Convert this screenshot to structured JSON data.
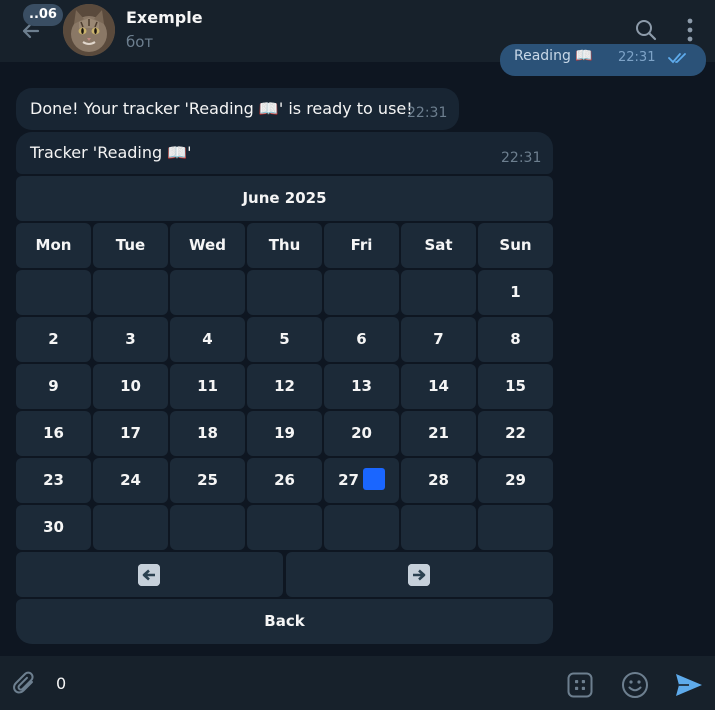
{
  "header": {
    "unread_count": "..06",
    "title": "Exemple",
    "subtitle": "бот",
    "icons": [
      "back-arrow-icon",
      "search-icon",
      "more-vertical-icon"
    ]
  },
  "previous_message": {
    "text": "Reading 📖",
    "time": "22:31",
    "status": "read"
  },
  "messages": [
    {
      "text": "Done! Your tracker 'Reading 📖' is ready to use!",
      "time": "22:31"
    },
    {
      "text": "Tracker 'Reading 📖'",
      "time": "22:31"
    }
  ],
  "calendar": {
    "month_label": "June 2025",
    "weekdays": [
      "Mon",
      "Tue",
      "Wed",
      "Thu",
      "Fri",
      "Sat",
      "Sun"
    ],
    "weeks": [
      [
        "",
        "",
        "",
        "",
        "",
        "",
        "1"
      ],
      [
        "2",
        "3",
        "4",
        "5",
        "6",
        "7",
        "8"
      ],
      [
        "9",
        "10",
        "11",
        "12",
        "13",
        "14",
        "15"
      ],
      [
        "16",
        "17",
        "18",
        "19",
        "20",
        "21",
        "22"
      ],
      [
        "23",
        "24",
        "25",
        "26",
        "27",
        "28",
        "29"
      ],
      [
        "30",
        "",
        "",
        "",
        "",
        "",
        ""
      ]
    ],
    "marked_day": "27",
    "marked_color": "#1a66ff",
    "prev_icon": "left-arrow-icon",
    "next_icon": "right-arrow-icon",
    "back_label": "Back"
  },
  "composer": {
    "input_value": "0",
    "icons": [
      "paperclip-icon",
      "bot-commands-icon",
      "emoji-icon",
      "send-icon"
    ]
  },
  "colors": {
    "background": "#0e1621",
    "header": "#17212b",
    "bubble": "#182533",
    "button": "#1c2a38",
    "accent": "#5eabec",
    "muted": "#6d7f8f"
  }
}
